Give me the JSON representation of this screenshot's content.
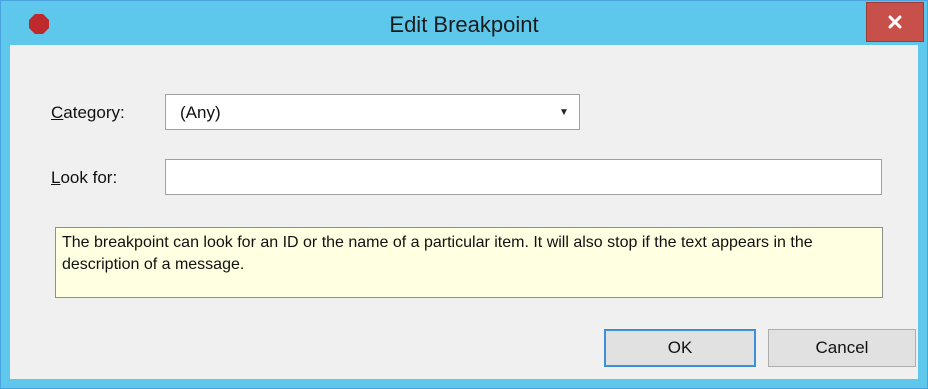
{
  "window": {
    "title": "Edit Breakpoint",
    "close_glyph": "x",
    "title_icon": "stop-sign-icon",
    "accent_color": "#5ec8ec",
    "close_color": "#c7504a",
    "stop_color": "#c0292b"
  },
  "form": {
    "category": {
      "label_accel": "C",
      "label_rest": "ategory:",
      "value": "(Any)"
    },
    "look_for": {
      "label_accel": "L",
      "label_rest": "ook for:",
      "value": ""
    },
    "info_text": "The breakpoint can look for an ID or the name of a particular item. It will also stop if the text appears in the description of a message."
  },
  "buttons": {
    "ok": "OK",
    "cancel": "Cancel"
  }
}
